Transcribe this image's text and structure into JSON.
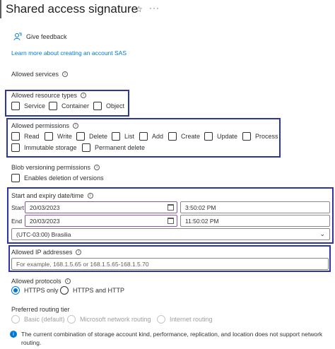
{
  "header": {
    "title": "Shared access signature",
    "star_icon": "☆",
    "more_icon": "···"
  },
  "toolbar": {
    "feedback_label": "Give feedback"
  },
  "learn_link": "Learn more about creating an account SAS",
  "allowed_services": {
    "label": "Allowed services"
  },
  "allowed_resource_types": {
    "label": "Allowed resource types",
    "options": [
      "Service",
      "Container",
      "Object"
    ]
  },
  "allowed_permissions": {
    "label": "Allowed permissions",
    "row1": [
      "Read",
      "Write",
      "Delete",
      "List",
      "Add",
      "Create",
      "Update",
      "Process"
    ],
    "row2": [
      "Immutable storage",
      "Permanent delete"
    ]
  },
  "blob_versioning": {
    "label": "Blob versioning permissions",
    "option": "Enables deletion of versions"
  },
  "datetime": {
    "label": "Start and expiry date/time",
    "start_label": "Start",
    "start_date": "20/03/2023",
    "start_time": "3:50:02 PM",
    "end_label": "End",
    "end_date": "20/03/2023",
    "end_time": "11:50:02 PM",
    "timezone": "(UTC-03:00) Brasilia"
  },
  "ip_addresses": {
    "label": "Allowed IP addresses",
    "placeholder": "For example, 168.1.5.65 or 168.1.5.65-168.1.5.70"
  },
  "protocols": {
    "label": "Allowed protocols",
    "options": [
      "HTTPS only",
      "HTTPS and HTTP"
    ],
    "selected": "HTTPS only"
  },
  "routing": {
    "label": "Preferred routing tier",
    "options": [
      "Basic (default)",
      "Microsoft network routing",
      "Internet routing"
    ]
  },
  "note": "The current combination of storage account kind, performance, replication, and location does not support network routing.",
  "colors": {
    "accent": "#0078d4",
    "highlight": "#2b35a8"
  }
}
